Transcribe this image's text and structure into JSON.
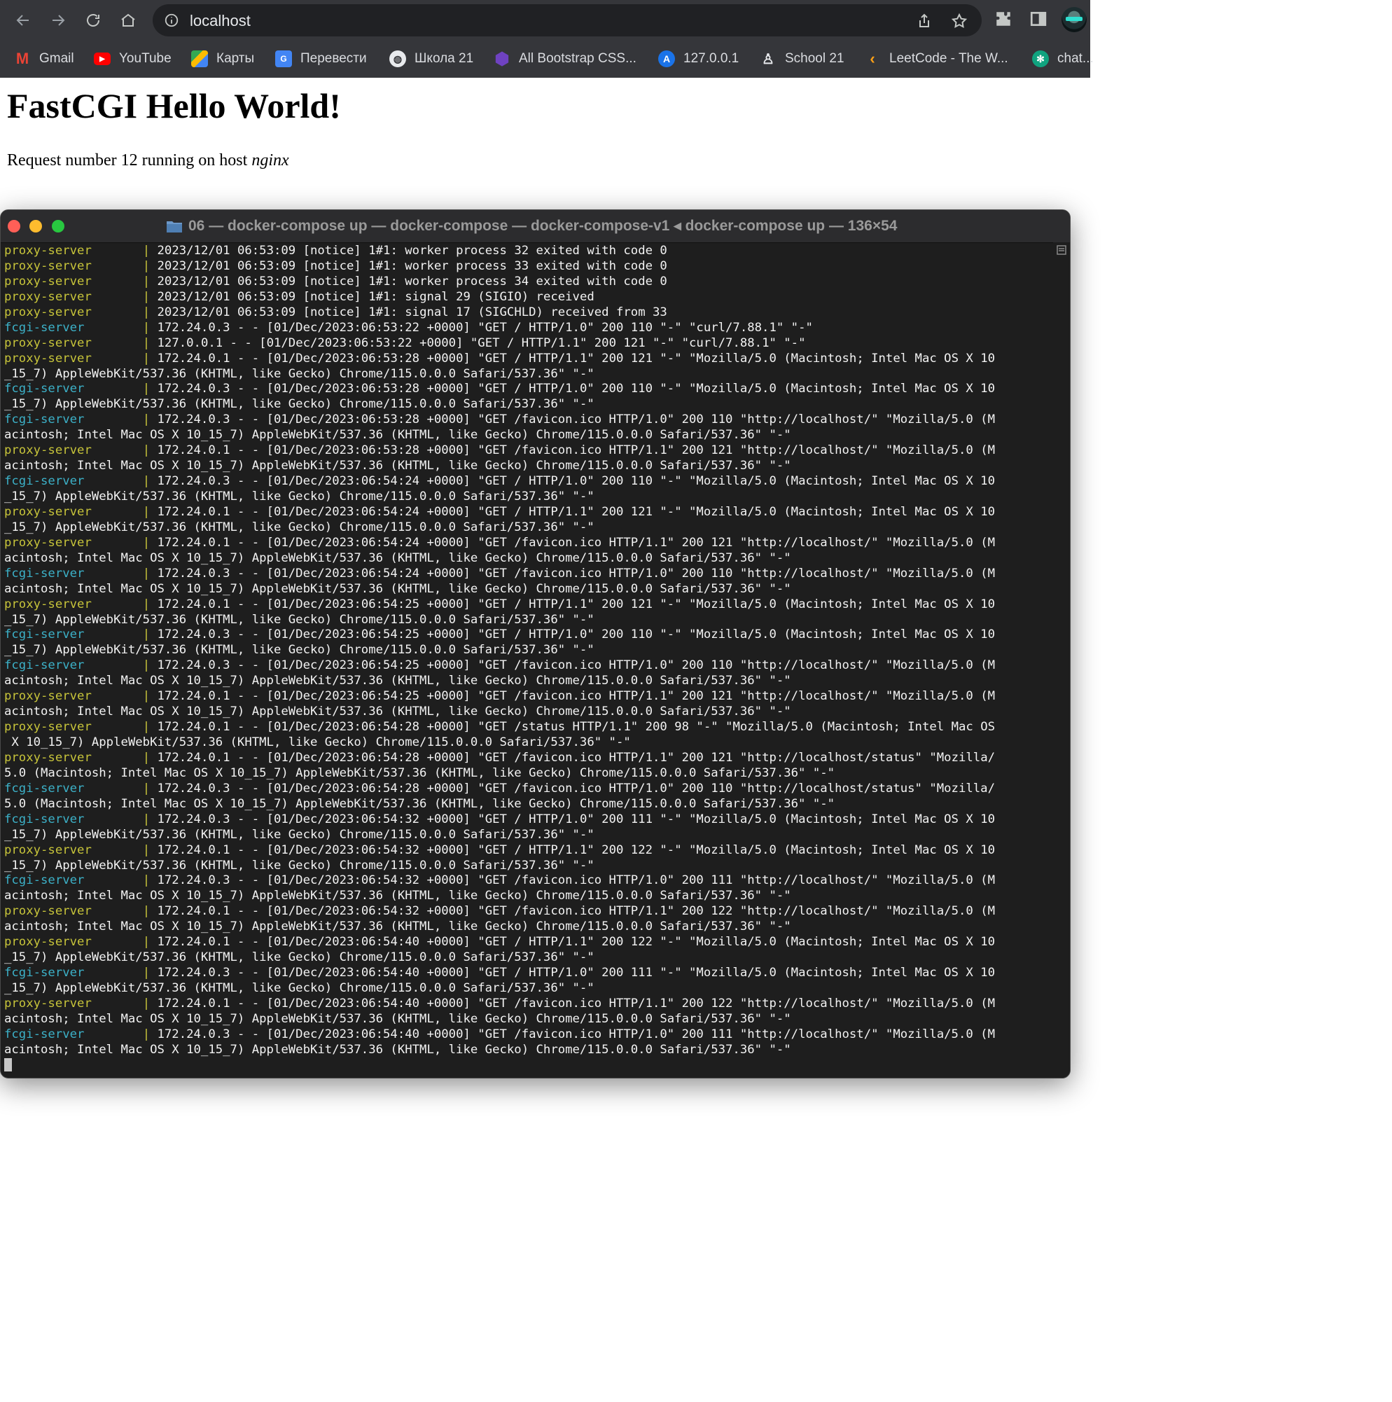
{
  "browser": {
    "url": "localhost",
    "bookmarks": [
      {
        "label": "Gmail",
        "icon": "gmail-icon"
      },
      {
        "label": "YouTube",
        "icon": "youtube-icon"
      },
      {
        "label": "Карты",
        "icon": "maps-icon"
      },
      {
        "label": "Перевести",
        "icon": "translate-icon"
      },
      {
        "label": "Школа 21",
        "icon": "globe-icon"
      },
      {
        "label": "All Bootstrap CSS...",
        "icon": "bootstrap-icon"
      },
      {
        "label": "127.0.0.1",
        "icon": "letter-a-icon"
      },
      {
        "label": "School 21",
        "icon": "school-icon"
      },
      {
        "label": "LeetCode - The W...",
        "icon": "leetcode-icon"
      },
      {
        "label": "chat...",
        "icon": "chatgpt-icon"
      }
    ]
  },
  "page": {
    "heading": "FastCGI Hello World!",
    "text_prefix": "Request number 12 running on host ",
    "host": "nginx"
  },
  "terminal": {
    "title": "06 — docker-compose up — docker-compose — docker-compose-v1 ◂ docker-compose up — 136×54",
    "traffic_colors": {
      "close": "#ff5f57",
      "minimize": "#febc2e",
      "zoom": "#28c840"
    },
    "lines": [
      {
        "svc": "proxy-server",
        "text": "2023/12/01 06:53:09 [notice] 1#1: worker process 32 exited with code 0"
      },
      {
        "svc": "proxy-server",
        "text": "2023/12/01 06:53:09 [notice] 1#1: worker process 33 exited with code 0"
      },
      {
        "svc": "proxy-server",
        "text": "2023/12/01 06:53:09 [notice] 1#1: worker process 34 exited with code 0"
      },
      {
        "svc": "proxy-server",
        "text": "2023/12/01 06:53:09 [notice] 1#1: signal 29 (SIGIO) received"
      },
      {
        "svc": "proxy-server",
        "text": "2023/12/01 06:53:09 [notice] 1#1: signal 17 (SIGCHLD) received from 33"
      },
      {
        "svc": "fcgi-server",
        "text": "172.24.0.3 - - [01/Dec/2023:06:53:22 +0000] \"GET / HTTP/1.0\" 200 110 \"-\" \"curl/7.88.1\" \"-\""
      },
      {
        "svc": "proxy-server",
        "text": "127.0.0.1 - - [01/Dec/2023:06:53:22 +0000] \"GET / HTTP/1.1\" 200 121 \"-\" \"curl/7.88.1\" \"-\""
      },
      {
        "svc": "proxy-server",
        "text": "172.24.0.1 - - [01/Dec/2023:06:53:28 +0000] \"GET / HTTP/1.1\" 200 121 \"-\" \"Mozilla/5.0 (Macintosh; Intel Mac OS X 10"
      },
      {
        "svc": "",
        "text": "_15_7) AppleWebKit/537.36 (KHTML, like Gecko) Chrome/115.0.0.0 Safari/537.36\" \"-\""
      },
      {
        "svc": "fcgi-server",
        "text": "172.24.0.3 - - [01/Dec/2023:06:53:28 +0000] \"GET / HTTP/1.0\" 200 110 \"-\" \"Mozilla/5.0 (Macintosh; Intel Mac OS X 10"
      },
      {
        "svc": "",
        "text": "_15_7) AppleWebKit/537.36 (KHTML, like Gecko) Chrome/115.0.0.0 Safari/537.36\" \"-\""
      },
      {
        "svc": "fcgi-server",
        "text": "172.24.0.3 - - [01/Dec/2023:06:53:28 +0000] \"GET /favicon.ico HTTP/1.0\" 200 110 \"http://localhost/\" \"Mozilla/5.0 (M"
      },
      {
        "svc": "",
        "text": "acintosh; Intel Mac OS X 10_15_7) AppleWebKit/537.36 (KHTML, like Gecko) Chrome/115.0.0.0 Safari/537.36\" \"-\""
      },
      {
        "svc": "proxy-server",
        "text": "172.24.0.1 - - [01/Dec/2023:06:53:28 +0000] \"GET /favicon.ico HTTP/1.1\" 200 121 \"http://localhost/\" \"Mozilla/5.0 (M"
      },
      {
        "svc": "",
        "text": "acintosh; Intel Mac OS X 10_15_7) AppleWebKit/537.36 (KHTML, like Gecko) Chrome/115.0.0.0 Safari/537.36\" \"-\""
      },
      {
        "svc": "fcgi-server",
        "text": "172.24.0.3 - - [01/Dec/2023:06:54:24 +0000] \"GET / HTTP/1.0\" 200 110 \"-\" \"Mozilla/5.0 (Macintosh; Intel Mac OS X 10"
      },
      {
        "svc": "",
        "text": "_15_7) AppleWebKit/537.36 (KHTML, like Gecko) Chrome/115.0.0.0 Safari/537.36\" \"-\""
      },
      {
        "svc": "proxy-server",
        "text": "172.24.0.1 - - [01/Dec/2023:06:54:24 +0000] \"GET / HTTP/1.1\" 200 121 \"-\" \"Mozilla/5.0 (Macintosh; Intel Mac OS X 10"
      },
      {
        "svc": "",
        "text": "_15_7) AppleWebKit/537.36 (KHTML, like Gecko) Chrome/115.0.0.0 Safari/537.36\" \"-\""
      },
      {
        "svc": "proxy-server",
        "text": "172.24.0.1 - - [01/Dec/2023:06:54:24 +0000] \"GET /favicon.ico HTTP/1.1\" 200 121 \"http://localhost/\" \"Mozilla/5.0 (M"
      },
      {
        "svc": "",
        "text": "acintosh; Intel Mac OS X 10_15_7) AppleWebKit/537.36 (KHTML, like Gecko) Chrome/115.0.0.0 Safari/537.36\" \"-\""
      },
      {
        "svc": "fcgi-server",
        "text": "172.24.0.3 - - [01/Dec/2023:06:54:24 +0000] \"GET /favicon.ico HTTP/1.0\" 200 110 \"http://localhost/\" \"Mozilla/5.0 (M"
      },
      {
        "svc": "",
        "text": "acintosh; Intel Mac OS X 10_15_7) AppleWebKit/537.36 (KHTML, like Gecko) Chrome/115.0.0.0 Safari/537.36\" \"-\""
      },
      {
        "svc": "proxy-server",
        "text": "172.24.0.1 - - [01/Dec/2023:06:54:25 +0000] \"GET / HTTP/1.1\" 200 121 \"-\" \"Mozilla/5.0 (Macintosh; Intel Mac OS X 10"
      },
      {
        "svc": "",
        "text": "_15_7) AppleWebKit/537.36 (KHTML, like Gecko) Chrome/115.0.0.0 Safari/537.36\" \"-\""
      },
      {
        "svc": "fcgi-server",
        "text": "172.24.0.3 - - [01/Dec/2023:06:54:25 +0000] \"GET / HTTP/1.0\" 200 110 \"-\" \"Mozilla/5.0 (Macintosh; Intel Mac OS X 10"
      },
      {
        "svc": "",
        "text": "_15_7) AppleWebKit/537.36 (KHTML, like Gecko) Chrome/115.0.0.0 Safari/537.36\" \"-\""
      },
      {
        "svc": "fcgi-server",
        "text": "172.24.0.3 - - [01/Dec/2023:06:54:25 +0000] \"GET /favicon.ico HTTP/1.0\" 200 110 \"http://localhost/\" \"Mozilla/5.0 (M"
      },
      {
        "svc": "",
        "text": "acintosh; Intel Mac OS X 10_15_7) AppleWebKit/537.36 (KHTML, like Gecko) Chrome/115.0.0.0 Safari/537.36\" \"-\""
      },
      {
        "svc": "proxy-server",
        "text": "172.24.0.1 - - [01/Dec/2023:06:54:25 +0000] \"GET /favicon.ico HTTP/1.1\" 200 121 \"http://localhost/\" \"Mozilla/5.0 (M"
      },
      {
        "svc": "",
        "text": "acintosh; Intel Mac OS X 10_15_7) AppleWebKit/537.36 (KHTML, like Gecko) Chrome/115.0.0.0 Safari/537.36\" \"-\""
      },
      {
        "svc": "proxy-server",
        "text": "172.24.0.1 - - [01/Dec/2023:06:54:28 +0000] \"GET /status HTTP/1.1\" 200 98 \"-\" \"Mozilla/5.0 (Macintosh; Intel Mac OS"
      },
      {
        "svc": "",
        "text": " X 10_15_7) AppleWebKit/537.36 (KHTML, like Gecko) Chrome/115.0.0.0 Safari/537.36\" \"-\""
      },
      {
        "svc": "proxy-server",
        "text": "172.24.0.1 - - [01/Dec/2023:06:54:28 +0000] \"GET /favicon.ico HTTP/1.1\" 200 121 \"http://localhost/status\" \"Mozilla/"
      },
      {
        "svc": "",
        "text": "5.0 (Macintosh; Intel Mac OS X 10_15_7) AppleWebKit/537.36 (KHTML, like Gecko) Chrome/115.0.0.0 Safari/537.36\" \"-\""
      },
      {
        "svc": "fcgi-server",
        "text": "172.24.0.3 - - [01/Dec/2023:06:54:28 +0000] \"GET /favicon.ico HTTP/1.0\" 200 110 \"http://localhost/status\" \"Mozilla/"
      },
      {
        "svc": "",
        "text": "5.0 (Macintosh; Intel Mac OS X 10_15_7) AppleWebKit/537.36 (KHTML, like Gecko) Chrome/115.0.0.0 Safari/537.36\" \"-\""
      },
      {
        "svc": "fcgi-server",
        "text": "172.24.0.3 - - [01/Dec/2023:06:54:32 +0000] \"GET / HTTP/1.0\" 200 111 \"-\" \"Mozilla/5.0 (Macintosh; Intel Mac OS X 10"
      },
      {
        "svc": "",
        "text": "_15_7) AppleWebKit/537.36 (KHTML, like Gecko) Chrome/115.0.0.0 Safari/537.36\" \"-\""
      },
      {
        "svc": "proxy-server",
        "text": "172.24.0.1 - - [01/Dec/2023:06:54:32 +0000] \"GET / HTTP/1.1\" 200 122 \"-\" \"Mozilla/5.0 (Macintosh; Intel Mac OS X 10"
      },
      {
        "svc": "",
        "text": "_15_7) AppleWebKit/537.36 (KHTML, like Gecko) Chrome/115.0.0.0 Safari/537.36\" \"-\""
      },
      {
        "svc": "fcgi-server",
        "text": "172.24.0.3 - - [01/Dec/2023:06:54:32 +0000] \"GET /favicon.ico HTTP/1.0\" 200 111 \"http://localhost/\" \"Mozilla/5.0 (M"
      },
      {
        "svc": "",
        "text": "acintosh; Intel Mac OS X 10_15_7) AppleWebKit/537.36 (KHTML, like Gecko) Chrome/115.0.0.0 Safari/537.36\" \"-\""
      },
      {
        "svc": "proxy-server",
        "text": "172.24.0.1 - - [01/Dec/2023:06:54:32 +0000] \"GET /favicon.ico HTTP/1.1\" 200 122 \"http://localhost/\" \"Mozilla/5.0 (M"
      },
      {
        "svc": "",
        "text": "acintosh; Intel Mac OS X 10_15_7) AppleWebKit/537.36 (KHTML, like Gecko) Chrome/115.0.0.0 Safari/537.36\" \"-\""
      },
      {
        "svc": "proxy-server",
        "text": "172.24.0.1 - - [01/Dec/2023:06:54:40 +0000] \"GET / HTTP/1.1\" 200 122 \"-\" \"Mozilla/5.0 (Macintosh; Intel Mac OS X 10"
      },
      {
        "svc": "",
        "text": "_15_7) AppleWebKit/537.36 (KHTML, like Gecko) Chrome/115.0.0.0 Safari/537.36\" \"-\""
      },
      {
        "svc": "fcgi-server",
        "text": "172.24.0.3 - - [01/Dec/2023:06:54:40 +0000] \"GET / HTTP/1.0\" 200 111 \"-\" \"Mozilla/5.0 (Macintosh; Intel Mac OS X 10"
      },
      {
        "svc": "",
        "text": "_15_7) AppleWebKit/537.36 (KHTML, like Gecko) Chrome/115.0.0.0 Safari/537.36\" \"-\""
      },
      {
        "svc": "proxy-server",
        "text": "172.24.0.1 - - [01/Dec/2023:06:54:40 +0000] \"GET /favicon.ico HTTP/1.1\" 200 122 \"http://localhost/\" \"Mozilla/5.0 (M"
      },
      {
        "svc": "",
        "text": "acintosh; Intel Mac OS X 10_15_7) AppleWebKit/537.36 (KHTML, like Gecko) Chrome/115.0.0.0 Safari/537.36\" \"-\""
      },
      {
        "svc": "fcgi-server",
        "text": "172.24.0.3 - - [01/Dec/2023:06:54:40 +0000] \"GET /favicon.ico HTTP/1.0\" 200 111 \"http://localhost/\" \"Mozilla/5.0 (M"
      },
      {
        "svc": "",
        "text": "acintosh; Intel Mac OS X 10_15_7) AppleWebKit/537.36 (KHTML, like Gecko) Chrome/115.0.0.0 Safari/537.36\" \"-\""
      }
    ]
  }
}
